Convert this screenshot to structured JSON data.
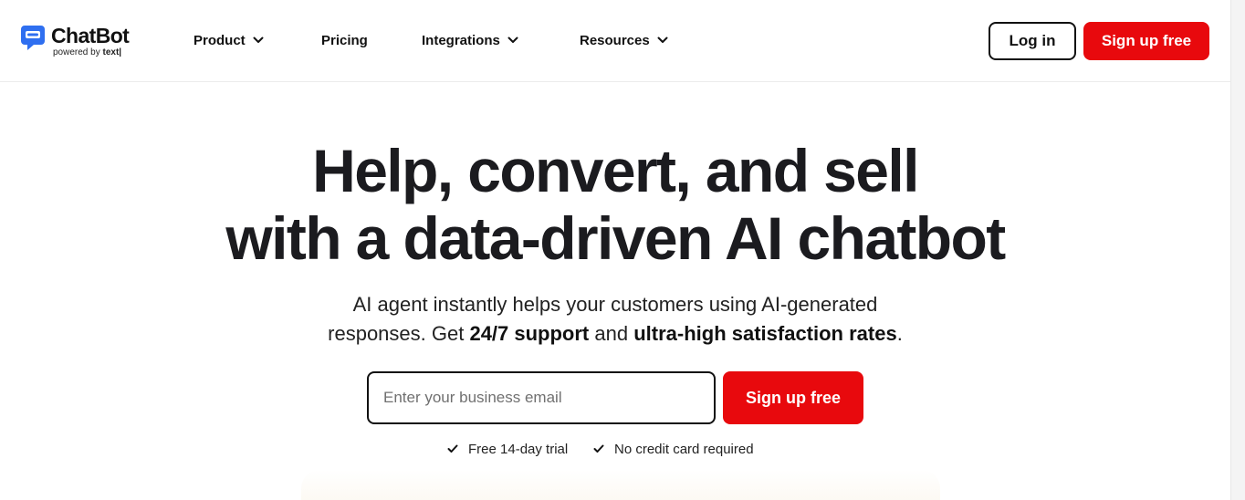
{
  "header": {
    "logo": {
      "name": "ChatBot",
      "powered_prefix": "powered by",
      "powered_brand": "text|",
      "icon": "chat-bubble-icon"
    },
    "nav": [
      {
        "label": "Product",
        "has_dropdown": true
      },
      {
        "label": "Pricing",
        "has_dropdown": false
      },
      {
        "label": "Integrations",
        "has_dropdown": true
      },
      {
        "label": "Resources",
        "has_dropdown": true
      }
    ],
    "login_label": "Log in",
    "signup_label": "Sign up free"
  },
  "hero": {
    "title_line1": "Help, convert, and sell",
    "title_line2": "with a data-driven AI chatbot",
    "subtitle_line1": "AI agent instantly helps your customers using AI-generated",
    "subtitle_line2_prefix": "responses. Get ",
    "subtitle_bold1": "24/7 support",
    "subtitle_mid": " and ",
    "subtitle_bold2": "ultra-high satisfaction rates",
    "subtitle_suffix": ".",
    "email_placeholder": "Enter your business email",
    "email_value": "",
    "cta_label": "Sign up free",
    "perks": [
      "Free 14-day trial",
      "No credit card required"
    ]
  },
  "colors": {
    "brand_red": "#e8090d",
    "logo_blue": "#2f6ff0",
    "text_dark": "#1b1b1f"
  }
}
